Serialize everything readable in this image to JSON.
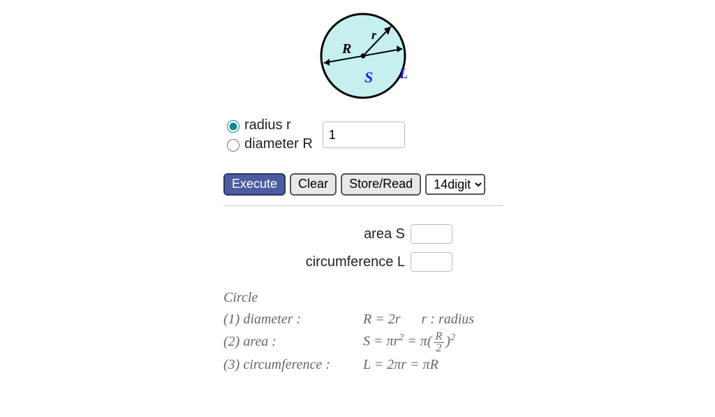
{
  "diagram": {
    "R_label": "R",
    "r_label": "r",
    "S_label": "S",
    "L_label": "L"
  },
  "inputs": {
    "radio_radius_label": "radius r",
    "radio_diameter_label": "diameter R",
    "value": "1"
  },
  "buttons": {
    "execute": "Execute",
    "clear": "Clear",
    "store_read": "Store/Read"
  },
  "precision": {
    "selected": "14digit"
  },
  "outputs": {
    "area_label": "area S",
    "area_value": "",
    "circumference_label": "circumference L",
    "circumference_value": ""
  },
  "formulas": {
    "title": "Circle",
    "line1_lhs": "(1) diameter :",
    "line1_rhs_a": "R = 2r",
    "line1_rhs_b": "r :  radius",
    "line2_lhs": "(2) area :",
    "line2_rhs_prefix": "S = πr",
    "line2_rhs_mid": " = π(",
    "line2_frac_num": "R",
    "line2_frac_den": "2",
    "line2_rhs_suffix": ")",
    "line3_lhs": "(3) circumference :",
    "line3_rhs": "L = 2πr = πR"
  }
}
